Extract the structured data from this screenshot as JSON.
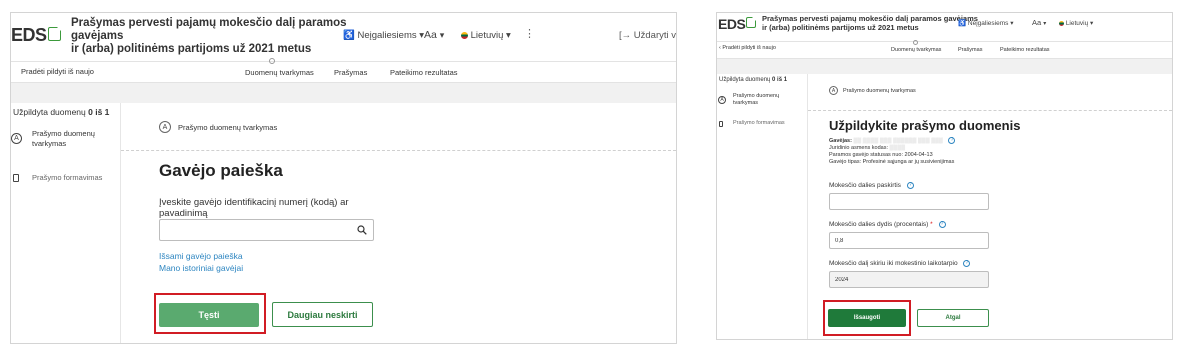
{
  "left": {
    "logo": "EDS",
    "title": "Prašymas pervesti pajamų mokesčio dalį paramos gavėjams ir (arba) politinėms partijoms už 2021 metus",
    "title_line1": "Prašymas pervesti pajamų mokesčio dalį paramos",
    "title_line2": "gavėjams",
    "title_line3": "ir (arba) politinėms partijoms už 2021 metus",
    "header": {
      "disabled": "Neįgaliesiems",
      "font": "Aa",
      "language": "Lietuvių",
      "close": "Uždaryti vedl"
    },
    "restart": "Pradėti pildyti iš naujo",
    "steps": [
      "Duomenų tvarkymas",
      "Prašymas",
      "Pateikimo rezultatas"
    ],
    "sidebar": {
      "progress_label": "Užpildyta duomenų",
      "progress_value": "0 iš 1",
      "item1_l1": "Prašymo duomenų",
      "item1_l2": "tvarkymas",
      "item2": "Prašymo formavimas"
    },
    "main": {
      "step_badge": "A",
      "step_label": "Prašymo duomenų tvarkymas",
      "heading": "Gavėjo paieška",
      "field_label_l1": "Įveskite gavėjo identifikacinį numerį (kodą) ar",
      "field_label_l2": "pavadinimą",
      "field_value": "",
      "link1": "Išsami gavėjo paieška",
      "link2": "Mano istoriniai gavėjai",
      "primary_btn": "Tęsti",
      "secondary_btn": "Daugiau neskirti"
    }
  },
  "right": {
    "logo": "EDS",
    "title_line1": "Prašymas pervesti pajamų mokesčio dalį paramos gavėjams",
    "title_line2": "ir (arba) politinėms partijoms už 2021 metus",
    "header": {
      "disabled": "Neįgaliesiems",
      "font": "Aa",
      "language": "Lietuvių"
    },
    "restart": "Pradėti pildyti iš naujo",
    "steps": [
      "Duomenų tvarkymas",
      "Prašymas",
      "Pateikimo rezultatas"
    ],
    "sidebar": {
      "progress_label": "Užpildyta duomenų",
      "progress_value": "0 iš 1",
      "item1_l1": "Prašymo duomenų",
      "item1_l2": "tvarkymas",
      "item2": "Prašymo formavimas"
    },
    "main": {
      "step_badge": "A",
      "step_label": "Prašymo duomenų tvarkymas",
      "heading": "Užpildykite prašymo duomenis",
      "info_recipient": "Gavėjas: ",
      "info_code": "Juridinio asmens kodas: ",
      "info_status": "Paramos gavėjo statusas nuo: 2004-04-13",
      "info_type": "Gavėjo tipas: Profesinė sąjunga ar jų susivienijimas",
      "field1_label": "Mokesčio dalies paskirtis",
      "field1_value": "",
      "field2_label": "Mokesčio dalies dydis (procentais)",
      "field2_required": "*",
      "field2_value": "0,8",
      "field3_label": "Mokesčio dalį skiriu iki mokestinio laikotarpio",
      "field3_value": "2024",
      "primary_btn": "Išsaugoti",
      "secondary_btn": "Atgal"
    }
  },
  "colors": {
    "accent": "#3c9a3c",
    "button": "#5aaa6f",
    "button_dark": "#1f7a3a",
    "highlight": "#d11c24",
    "link": "#2e86c1"
  }
}
